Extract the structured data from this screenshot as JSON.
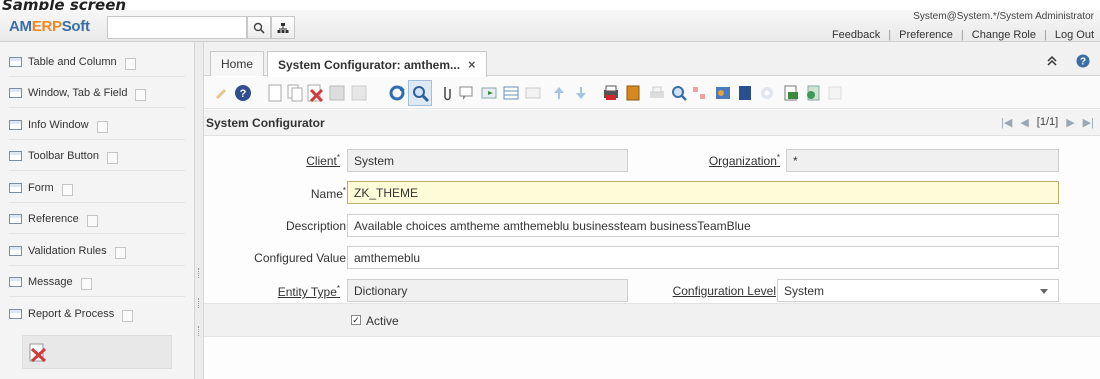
{
  "screen_label": "Sample screen",
  "header": {
    "logo": {
      "am": "AM",
      "erp": "ERP",
      "soft": "Soft"
    },
    "search_value": "",
    "user": "System@System.*/System Administrator",
    "links": [
      "Feedback",
      "Preference",
      "Change Role",
      "Log Out"
    ]
  },
  "sidebar": {
    "items": [
      {
        "label": "Table and Column"
      },
      {
        "label": "Window, Tab & Field"
      },
      {
        "label": "Info Window"
      },
      {
        "label": "Toolbar Button"
      },
      {
        "label": "Form"
      },
      {
        "label": "Reference"
      },
      {
        "label": "Validation Rules"
      },
      {
        "label": "Message"
      },
      {
        "label": "Report & Process"
      }
    ]
  },
  "tabs": [
    {
      "label": "Home"
    },
    {
      "label": "System Configurator: amthem...",
      "close": "×"
    }
  ],
  "window": {
    "title": "System Configurator",
    "pager": "[1/1]"
  },
  "form": {
    "client": {
      "label": "Client",
      "value": "System"
    },
    "organization": {
      "label": "Organization",
      "value": "*"
    },
    "name": {
      "label": "Name",
      "value": "ZK_THEME"
    },
    "description": {
      "label": "Description",
      "value": "Available choices amtheme amthemeblu businessteam businessTeamBlue"
    },
    "configured_value": {
      "label": "Configured Value",
      "value": "amthemeblu"
    },
    "entity_type": {
      "label": "Entity Type",
      "value": "Dictionary"
    },
    "configuration_level": {
      "label": "Configuration Level",
      "value": "System"
    },
    "active": {
      "label": "Active",
      "checked": true
    }
  },
  "colors": {
    "accent_blue": "#3a6ea5",
    "accent_orange": "#f08a24",
    "focus_bg": "#fffbd9"
  }
}
